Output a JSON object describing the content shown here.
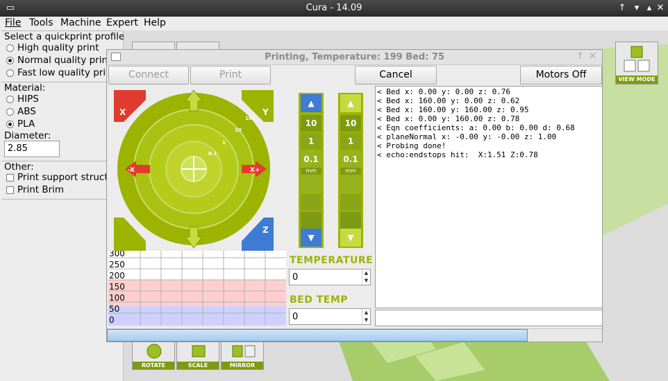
{
  "window": {
    "title": "Cura - 14.09"
  },
  "menu": [
    "File",
    "Tools",
    "Machine",
    "Expert",
    "Help"
  ],
  "left": {
    "profile_heading": "Select a quickprint profile",
    "profiles": [
      "High quality print",
      "Normal quality print",
      "Fast low quality print"
    ],
    "profile_selected": 1,
    "material_heading": "Material:",
    "materials": [
      "HIPS",
      "ABS",
      "PLA"
    ],
    "material_selected": 2,
    "diameter_label": "Diameter:",
    "diameter_value": "2.85",
    "other_heading": "Other:",
    "other": [
      "Print support structure",
      "Print Brim"
    ]
  },
  "viewport": {
    "view_mode": "VIEW MODE",
    "tools": [
      "ROTATE",
      "SCALE",
      "MIRROR"
    ]
  },
  "dialog": {
    "title": "Printing, Temperature: 199 Bed: 75",
    "buttons": {
      "connect": "Connect",
      "print": "Print",
      "cancel": "Cancel",
      "motors_off": "Motors Off"
    },
    "jog": {
      "steps": [
        "10",
        "1",
        "0.1"
      ],
      "ring_steps": [
        "0.1",
        "1",
        "10",
        "100"
      ]
    },
    "z_unit": "mm",
    "temperature_label": "TEMPERATURE",
    "temperature_value": "0",
    "bed_temp_label": "BED TEMP",
    "bed_temp_value": "0",
    "graph_labels": [
      "300",
      "250",
      "200",
      "150",
      "100",
      "50",
      "0"
    ],
    "log": [
      "< Bed x: 0.00 y: 0.00 z: 0.76",
      "< Bed x: 160.00 y: 0.00 z: 0.62",
      "< Bed x: 160.00 y: 160.00 z: 0.95",
      "< Bed x: 0.00 y: 160.00 z: 0.78",
      "< Eqn coefficients: a: 0.00 b: 0.00 d: 0.68",
      "< planeNormal x: -0.00 y: -0.00 z: 1.00",
      "< Probing done!",
      "< echo:endstops hit:  X:1.51 Z:0.78"
    ],
    "progress": 0.85
  }
}
